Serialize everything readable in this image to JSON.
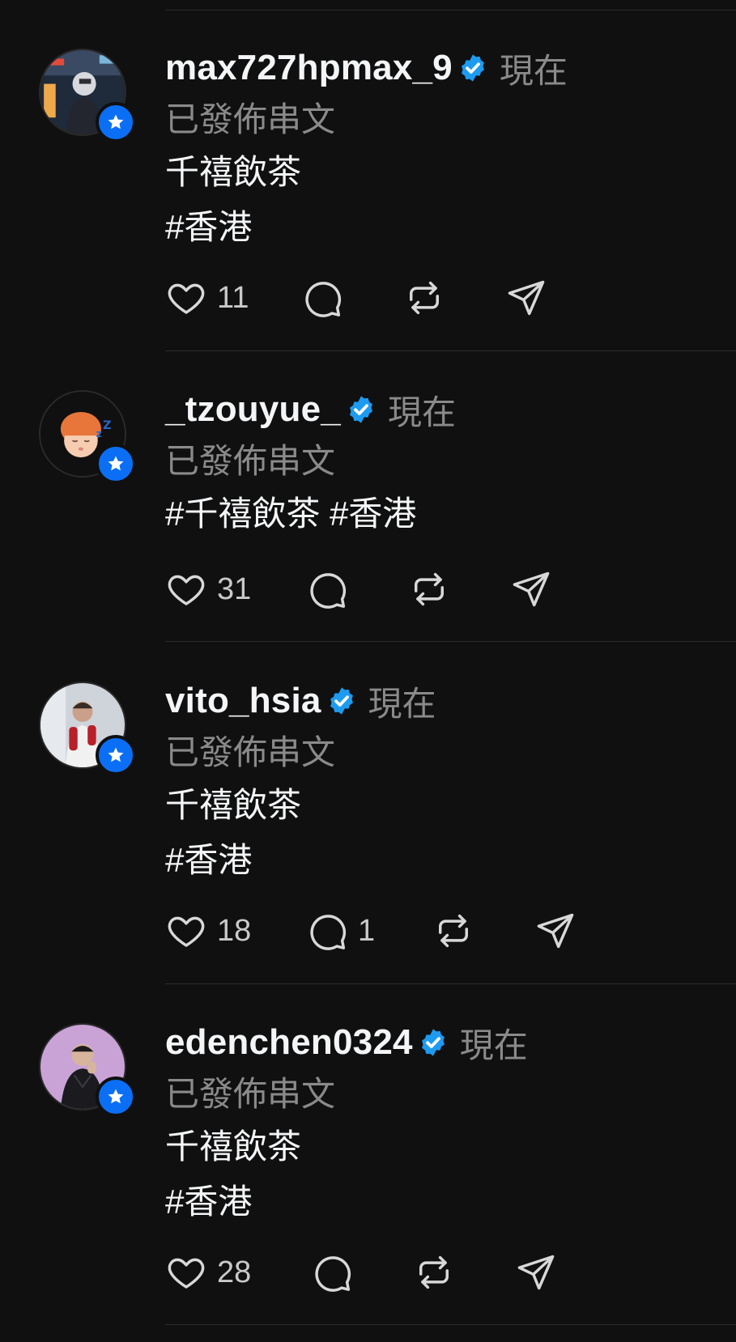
{
  "theme": {
    "background": "#101010",
    "accent_blue": "#0a6ff5",
    "verified_blue": "#1d9bf0",
    "muted_text": "#8a8a8a"
  },
  "posts": [
    {
      "username": "max727hpmax_9",
      "time": "現在",
      "subtitle": "已發佈串文",
      "lines": [
        "千禧飲茶",
        "#香港"
      ],
      "likes": "11",
      "replies": "",
      "avatar": "person-hoodie-night-photo"
    },
    {
      "username": "_tzouyue_",
      "time": "現在",
      "subtitle": "已發佈串文",
      "lines": [
        "#千禧飲茶 #香港"
      ],
      "likes": "31",
      "replies": "",
      "avatar": "sleeping-memoji"
    },
    {
      "username": "vito_hsia",
      "time": "現在",
      "subtitle": "已發佈串文",
      "lines": [
        "千禧飲茶",
        "#香港"
      ],
      "likes": "18",
      "replies": "1",
      "avatar": "person-red-gloves-photo"
    },
    {
      "username": "edenchen0324",
      "time": "現在",
      "subtitle": "已發佈串文",
      "lines": [
        "千禧飲茶",
        "#香港"
      ],
      "likes": "28",
      "replies": "",
      "avatar": "person-purple-background-photo"
    }
  ]
}
